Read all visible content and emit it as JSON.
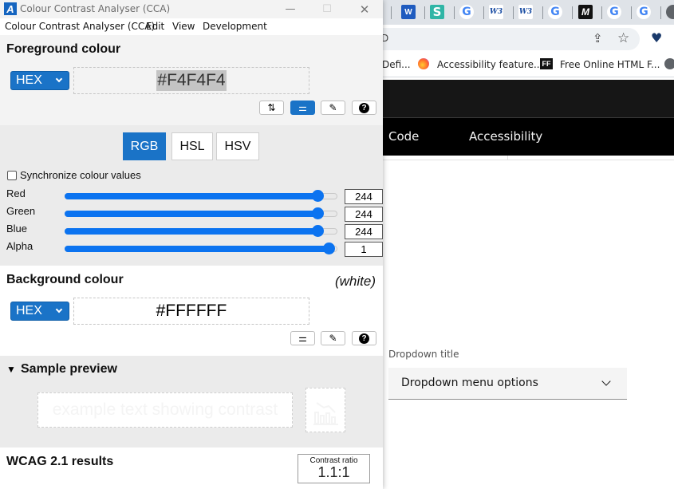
{
  "browser": {
    "tabs": [
      {
        "icon": "word-icon",
        "glyph": "W"
      },
      {
        "icon": "s-icon",
        "glyph": "S"
      },
      {
        "icon": "google-icon",
        "glyph": "G"
      },
      {
        "icon": "w3-icon",
        "glyph": "W3"
      },
      {
        "icon": "w3-icon",
        "glyph": "W3"
      },
      {
        "icon": "google-icon",
        "glyph": "G"
      },
      {
        "icon": "m-icon",
        "glyph": "M"
      },
      {
        "icon": "google-icon",
        "glyph": "G"
      },
      {
        "icon": "google-icon",
        "glyph": "G"
      },
      {
        "icon": "chrome-icon",
        "glyph": ""
      }
    ],
    "address_fragment": "D",
    "toolbar": {
      "share_glyph": "⇪",
      "star_glyph": "☆",
      "extension_glyph": "♥"
    },
    "bookmarks": [
      {
        "label": "Defi..."
      },
      {
        "label": "Accessibility feature..."
      },
      {
        "label": "Free Online HTML F..."
      }
    ],
    "bookmark_ff_glyph": "FF",
    "site": {
      "nav": [
        "Code",
        "Accessibility"
      ],
      "dropdown_title": "Dropdown title",
      "dropdown_value": "Dropdown menu options"
    }
  },
  "cca": {
    "window_title": "Colour Contrast Analyser (CCA)",
    "app_icon_glyph": "A",
    "window_controls": {
      "minimize": "—",
      "maximize": "☐",
      "close": "✕"
    },
    "menu": [
      "Colour Contrast Analyser (CCA)",
      "Edit",
      "View",
      "Development"
    ],
    "foreground": {
      "heading": "Foreground colour",
      "format": "HEX",
      "value": "#F4F4F4",
      "buttons": {
        "swap": "⇅",
        "sliders": "⚌",
        "picker": "✎",
        "help": "?"
      }
    },
    "modes": {
      "tabs": [
        "RGB",
        "HSL",
        "HSV"
      ],
      "active": "RGB"
    },
    "sync_label": "Synchronize colour values",
    "sync_checked": false,
    "sliders": [
      {
        "label": "Red",
        "value": "244",
        "max": 255
      },
      {
        "label": "Green",
        "value": "244",
        "max": 255
      },
      {
        "label": "Blue",
        "value": "244",
        "max": 255
      },
      {
        "label": "Alpha",
        "value": "1",
        "max": 1
      }
    ],
    "background": {
      "heading": "Background colour",
      "name_note": "(white)",
      "format": "HEX",
      "value": "#FFFFFF",
      "buttons": {
        "sliders": "⚌",
        "picker": "✎",
        "help": "?"
      }
    },
    "preview": {
      "caret": "▼",
      "heading": "Sample preview",
      "sample_text": "example text showing contrast"
    },
    "results": {
      "heading": "WCAG 2.1 results",
      "ratio_label": "Contrast ratio",
      "ratio_value": "1.1:1"
    },
    "colors": {
      "accent": "#1A73C7",
      "slider": "#0B73F0",
      "foreground": "#F4F4F4",
      "background": "#FFFFFF"
    }
  }
}
